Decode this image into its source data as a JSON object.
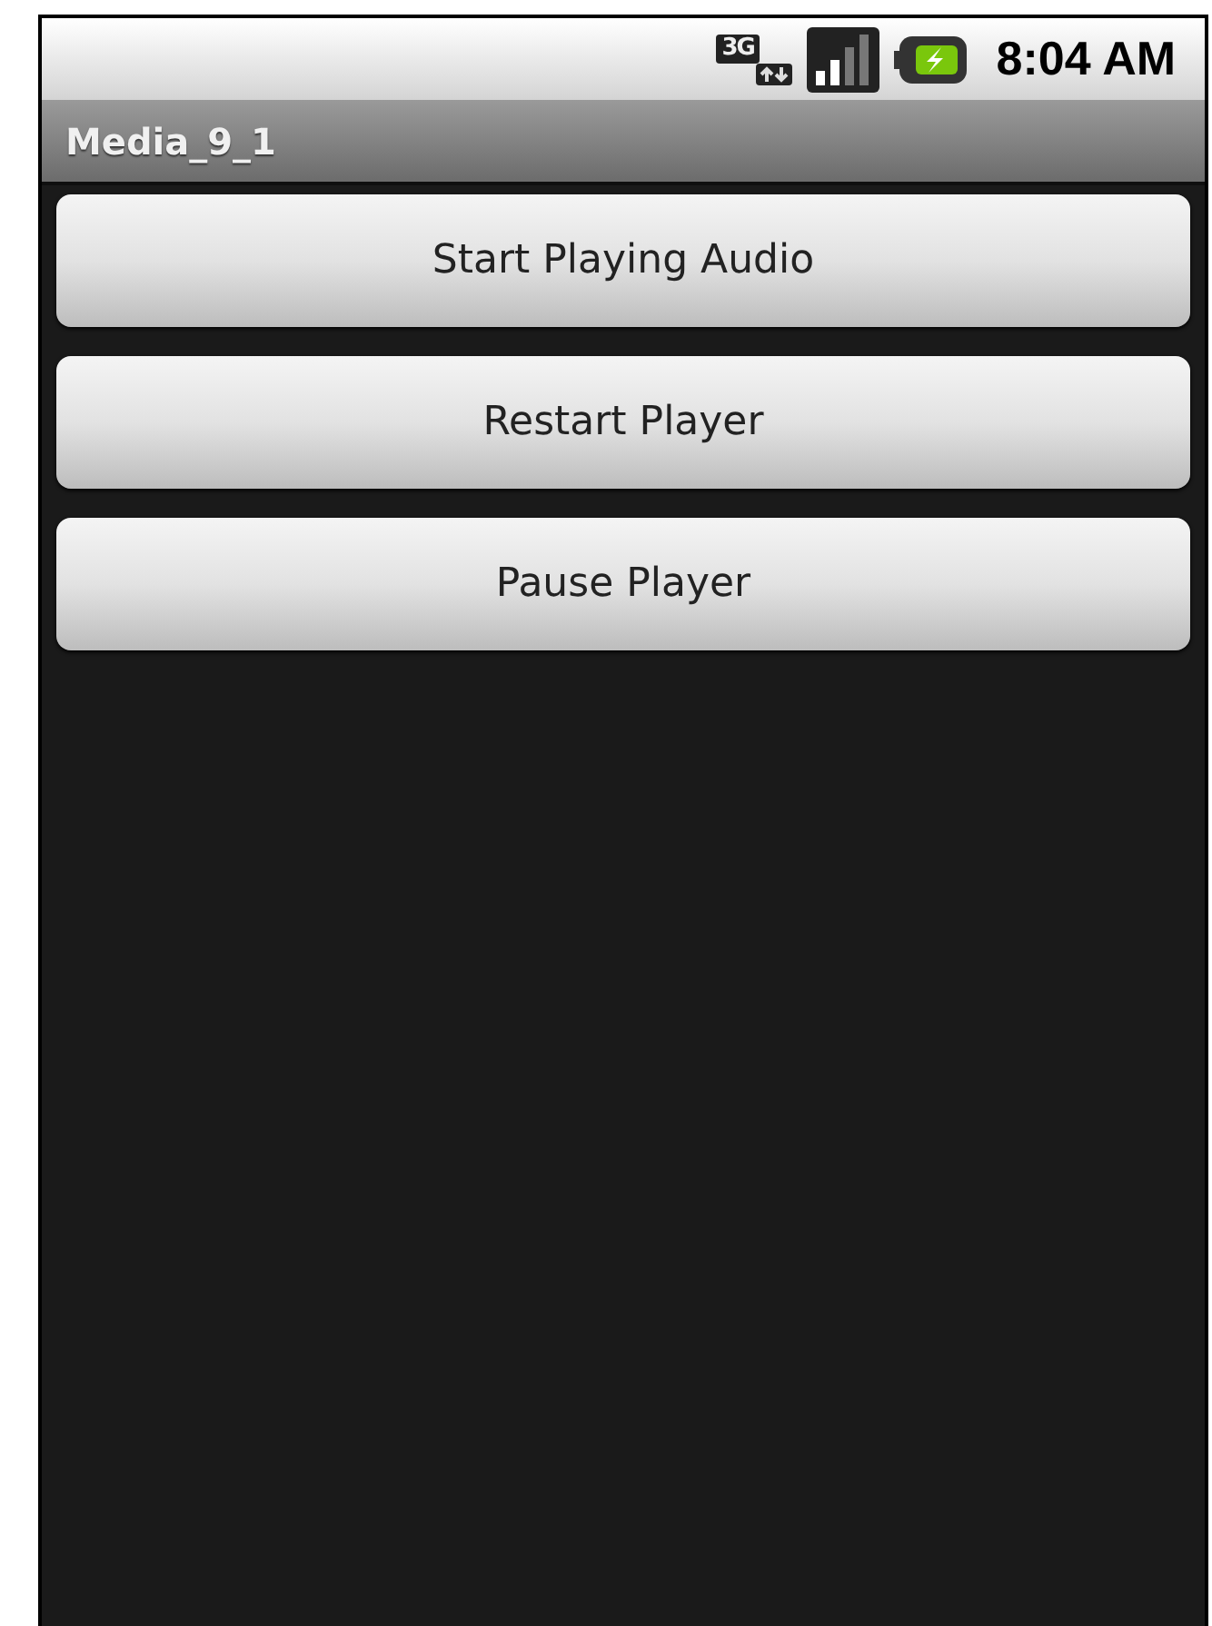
{
  "status_bar": {
    "network_type": "3G",
    "time": "8:04 AM"
  },
  "title_bar": {
    "title": "Media_9_1"
  },
  "buttons": [
    {
      "label": "Start Playing Audio"
    },
    {
      "label": "Restart Player"
    },
    {
      "label": "Pause Player"
    }
  ]
}
